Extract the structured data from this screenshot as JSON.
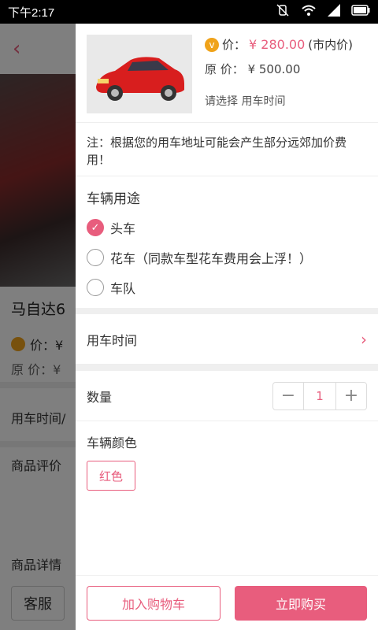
{
  "status_bar": {
    "time": "下午2:17"
  },
  "background_page": {
    "product_name": "马自达6",
    "price_label": "价：¥",
    "original_label": "原 价：¥",
    "row_time": "用车时间/",
    "row_review": "商品评价",
    "row_detail": "商品详情",
    "service_button": "客服"
  },
  "panel": {
    "product": {
      "price_label": "价：",
      "price_value": "¥ 280.00",
      "price_note": "(市内价)",
      "original_label": "原 价：",
      "original_value": "¥ 500.00",
      "select_hint": "请选择 用车时间"
    },
    "note": "注：根据您的用车地址可能会产生部分远郊加价费用！",
    "usage": {
      "title": "车辆用途",
      "options": [
        {
          "label": "头车",
          "checked": true
        },
        {
          "label": "花车（同款车型花车费用会上浮！）",
          "checked": false
        },
        {
          "label": "车队",
          "checked": false
        }
      ]
    },
    "time_row": {
      "label": "用车时间"
    },
    "quantity": {
      "label": "数量",
      "value": "1"
    },
    "color": {
      "title": "车辆颜色",
      "selected": "红色"
    },
    "buttons": {
      "add_cart": "加入购物车",
      "buy_now": "立即购买"
    }
  },
  "colors": {
    "accent": "#e85d7d",
    "badge": "#f0a31a"
  }
}
